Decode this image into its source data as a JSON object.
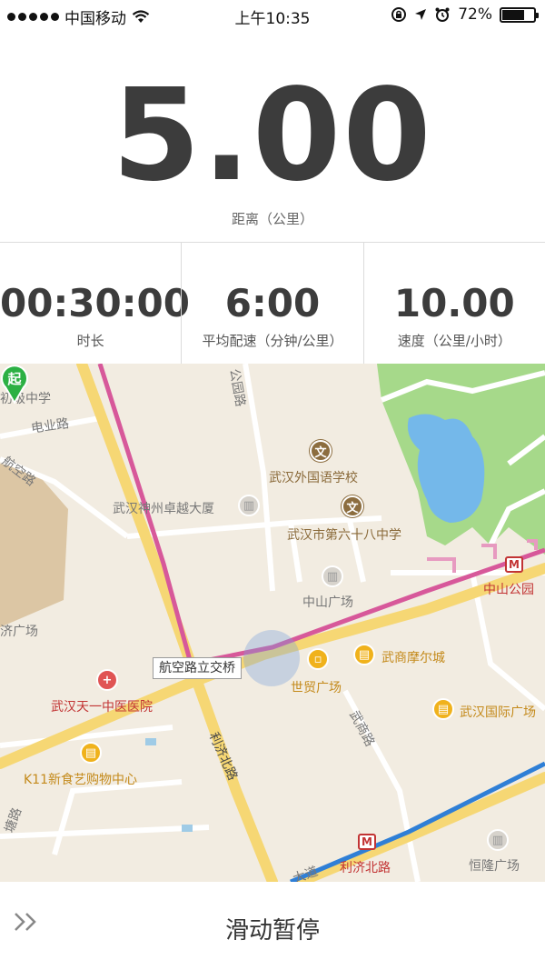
{
  "status_bar": {
    "carrier": "中国移动",
    "time": "上午10:35",
    "battery": "72%",
    "battery_level": 0.72,
    "icons": [
      "signal-dots",
      "wifi-icon",
      "rotation-lock-icon",
      "location-arrow-icon",
      "alarm-icon",
      "battery-icon"
    ]
  },
  "distance": {
    "value": "5.00",
    "label": "距离（公里）"
  },
  "stats": [
    {
      "value": "00:30:00",
      "label": "时长"
    },
    {
      "value": "6:00",
      "label": "平均配速（分钟/公里）"
    },
    {
      "value": "10.00",
      "label": "速度（公里/小时）"
    }
  ],
  "map": {
    "labels": {
      "school1": "初级中学",
      "road1": "电业路",
      "road2": "航空路",
      "road3": "公园路",
      "waihai": "武汉外国语学校",
      "shenzhou": "武汉神州卓越大厦",
      "no68": "武汉市第六十八中学",
      "zhongshan_sq": "中山广场",
      "zhongshan_park": "中山公园",
      "square_left": "济广场",
      "bridge": "航空路立交桥",
      "shimao": "世贸广场",
      "wushang_mall": "武商摩尔城",
      "wushang_road": "武商路",
      "tianyi": "武汉天一中医医院",
      "wuhan_intl": "武汉国际广场",
      "k11": "K11新食艺购物中心",
      "liji_road": "利济北路",
      "liji_station": "利济北路",
      "henglong": "恒隆广场",
      "road_bottom_left": "塘路",
      "road_bottom": "大道"
    },
    "colors": {
      "background": "#f2ece1",
      "park": "#a6d98a",
      "water": "#74b8ea",
      "metro_pink": "#d7589a",
      "road_yellow": "#f6d774",
      "metro_blue": "#2f7fd6"
    }
  },
  "bottom": {
    "arrows": "»",
    "slide_text": "滑动暂停"
  }
}
